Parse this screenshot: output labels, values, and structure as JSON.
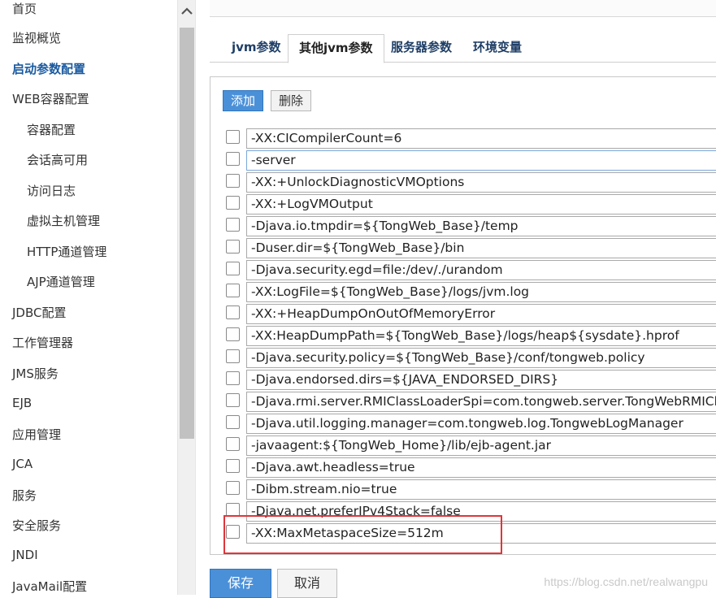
{
  "sidebar": {
    "items": [
      {
        "label": "首页"
      },
      {
        "label": "监视概览"
      },
      {
        "label": "启动参数配置"
      },
      {
        "label": "WEB容器配置"
      },
      {
        "label": "容器配置"
      },
      {
        "label": "会话高可用"
      },
      {
        "label": "访问日志"
      },
      {
        "label": "虚拟主机管理"
      },
      {
        "label": "HTTP通道管理"
      },
      {
        "label": "AJP通道管理"
      },
      {
        "label": "JDBC配置"
      },
      {
        "label": "工作管理器"
      },
      {
        "label": "JMS服务"
      },
      {
        "label": "EJB"
      },
      {
        "label": "应用管理"
      },
      {
        "label": "JCA"
      },
      {
        "label": "服务"
      },
      {
        "label": "安全服务"
      },
      {
        "label": "JNDI"
      },
      {
        "label": "JavaMail配置"
      }
    ]
  },
  "tabs": [
    {
      "label": "jvm参数"
    },
    {
      "label": "其他jvm参数"
    },
    {
      "label": "服务器参数"
    },
    {
      "label": "环境变量"
    }
  ],
  "toolbar": {
    "add_label": "添加",
    "delete_label": "删除"
  },
  "args": [
    {
      "value": "-XX:CICompilerCount=6"
    },
    {
      "value": "-server"
    },
    {
      "value": "-XX:+UnlockDiagnosticVMOptions"
    },
    {
      "value": "-XX:+LogVMOutput"
    },
    {
      "value": "-Djava.io.tmpdir=${TongWeb_Base}/temp"
    },
    {
      "value": "-Duser.dir=${TongWeb_Base}/bin"
    },
    {
      "value": "-Djava.security.egd=file:/dev/./urandom"
    },
    {
      "value": "-XX:LogFile=${TongWeb_Base}/logs/jvm.log"
    },
    {
      "value": "-XX:+HeapDumpOnOutOfMemoryError"
    },
    {
      "value": "-XX:HeapDumpPath=${TongWeb_Base}/logs/heap${sysdate}.hprof"
    },
    {
      "value": "-Djava.security.policy=${TongWeb_Base}/conf/tongweb.policy"
    },
    {
      "value": "-Djava.endorsed.dirs=${JAVA_ENDORSED_DIRS}"
    },
    {
      "value": "-Djava.rmi.server.RMIClassLoaderSpi=com.tongweb.server.TongWebRMIClassLoader"
    },
    {
      "value": "-Djava.util.logging.manager=com.tongweb.log.TongwebLogManager"
    },
    {
      "value": "-javaagent:${TongWeb_Home}/lib/ejb-agent.jar"
    },
    {
      "value": "-Djava.awt.headless=true"
    },
    {
      "value": "-Dibm.stream.nio=true"
    },
    {
      "value": "-Djava.net.preferIPv4Stack=false"
    },
    {
      "value": "-XX:MaxMetaspaceSize=512m"
    }
  ],
  "actions": {
    "save_label": "保存",
    "cancel_label": "取消"
  },
  "watermark": "https://blog.csdn.net/realwangpu",
  "colors": {
    "accent": "#4a90d9",
    "highlight": "#e0353a",
    "active_nav": "#1a5aa0"
  }
}
